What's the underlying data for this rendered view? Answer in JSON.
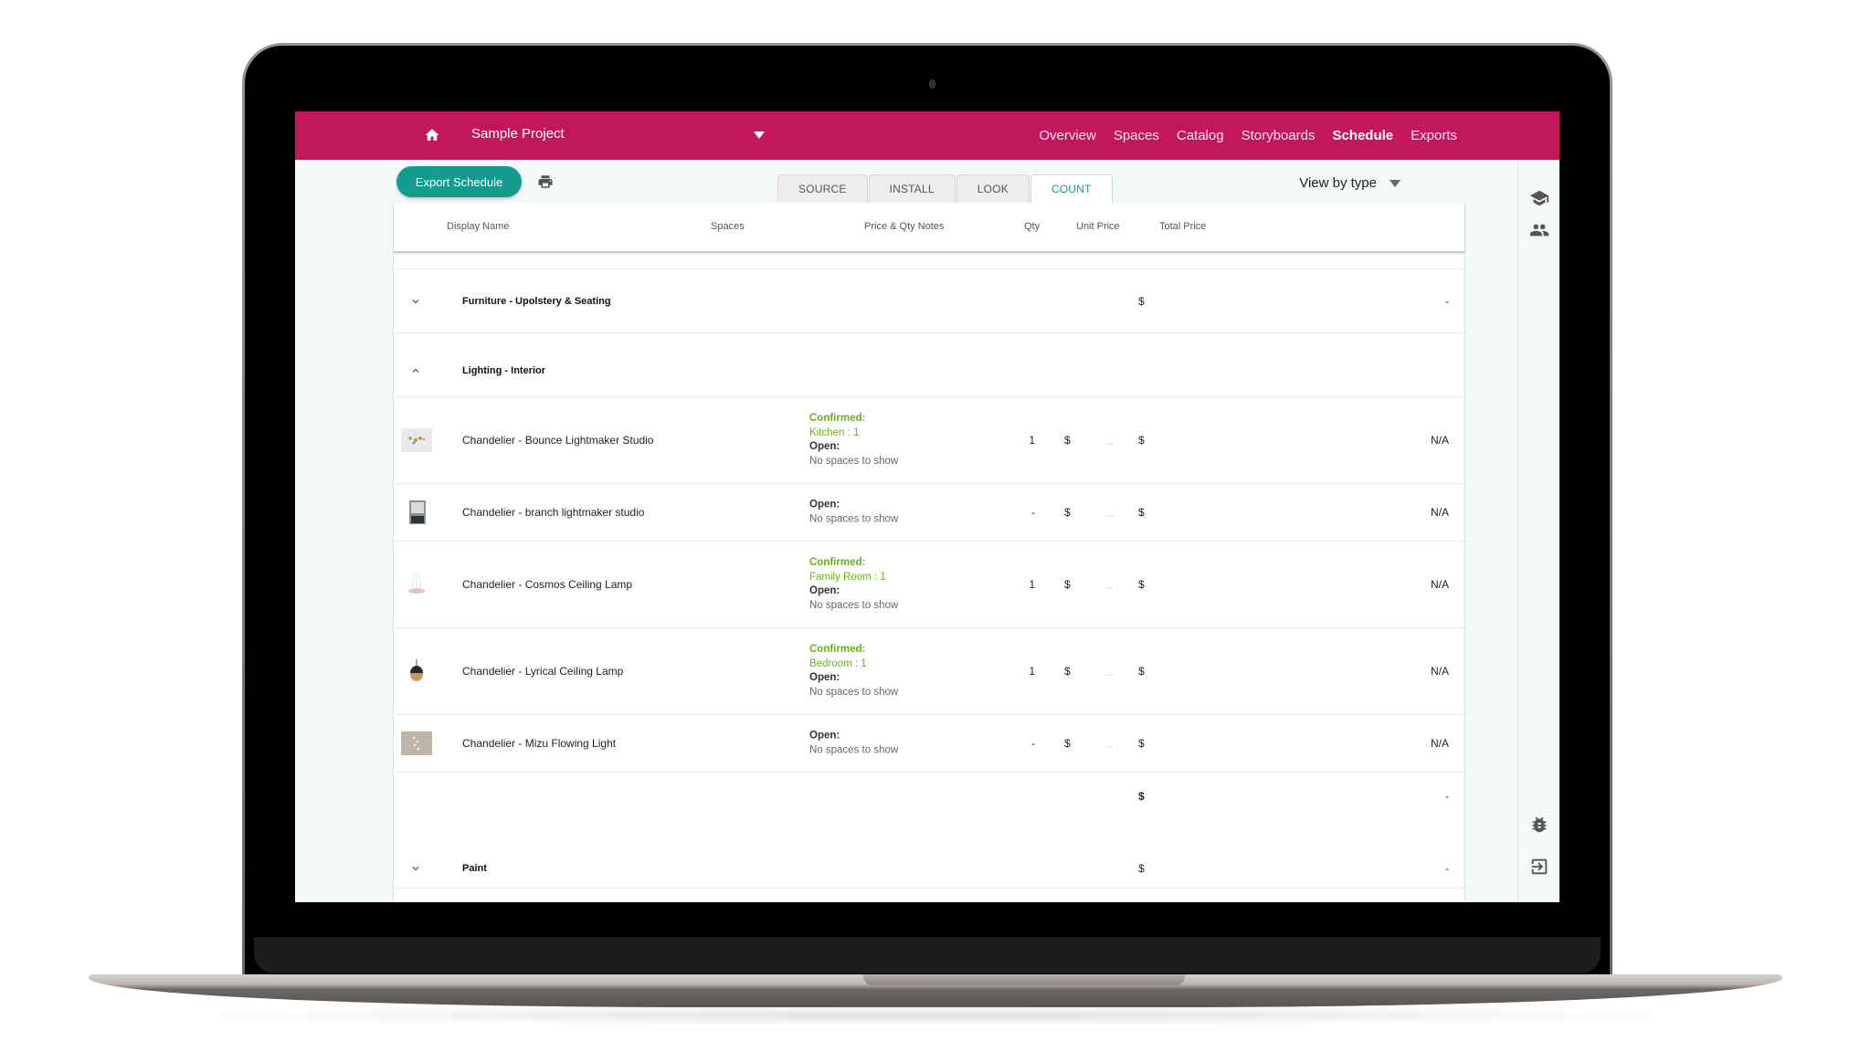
{
  "header": {
    "home_icon": "home-icon",
    "project_name": "Sample Project",
    "nav": [
      {
        "label": "Overview",
        "active": false
      },
      {
        "label": "Spaces",
        "active": false
      },
      {
        "label": "Catalog",
        "active": false
      },
      {
        "label": "Storyboards",
        "active": false
      },
      {
        "label": "Schedule",
        "active": true
      },
      {
        "label": "Exports",
        "active": false
      }
    ]
  },
  "toolbar": {
    "export_label": "Export Schedule",
    "print_icon": "print-icon",
    "tabs": [
      {
        "label": "SOURCE",
        "active": false
      },
      {
        "label": "INSTALL",
        "active": false
      },
      {
        "label": "LOOK",
        "active": false
      },
      {
        "label": "COUNT",
        "active": true
      }
    ],
    "view_by": "View by type"
  },
  "right_rail": {
    "icons": [
      "graduation-cap-icon",
      "people-icon",
      "bug-icon",
      "exit-icon"
    ]
  },
  "table": {
    "columns": {
      "display_name": "Display Name",
      "spaces": "Spaces",
      "price_notes": "Price & Qty Notes",
      "qty": "Qty",
      "unit_price": "Unit Price",
      "total_price": "Total Price"
    },
    "groups": [
      {
        "name": "Furniture - Upolstery & Seating",
        "expanded": false,
        "total_currency": "$",
        "total": "-"
      },
      {
        "name": "Lighting - Interior",
        "expanded": true
      },
      {
        "name": "Paint",
        "expanded": false,
        "total_currency": "$",
        "total": "-"
      }
    ],
    "items": [
      {
        "name": "Chandelier - Bounce Lightmaker Studio",
        "confirmed_label": "Confirmed:",
        "confirmed_value": "Kitchen : 1",
        "open_label": "Open:",
        "open_value": "No spaces to show",
        "qty": "1",
        "unit_currency": "$",
        "unit_price": "...",
        "total_currency": "$",
        "total_price": "N/A"
      },
      {
        "name": "Chandelier - branch lightmaker studio",
        "open_label": "Open:",
        "open_value": "No spaces to show",
        "qty": "-",
        "unit_currency": "$",
        "unit_price": "...",
        "total_currency": "$",
        "total_price": "N/A"
      },
      {
        "name": "Chandelier - Cosmos Ceiling Lamp",
        "confirmed_label": "Confirmed:",
        "confirmed_value": "Family Room : 1",
        "open_label": "Open:",
        "open_value": "No spaces to show",
        "qty": "1",
        "unit_currency": "$",
        "unit_price": "...",
        "total_currency": "$",
        "total_price": "N/A"
      },
      {
        "name": "Chandelier - Lyrical Ceiling Lamp",
        "confirmed_label": "Confirmed:",
        "confirmed_value": "Bedroom : 1",
        "open_label": "Open:",
        "open_value": "No spaces to show",
        "qty": "1",
        "unit_currency": "$",
        "unit_price": "...",
        "total_currency": "$",
        "total_price": "N/A"
      },
      {
        "name": "Chandelier - Mizu Flowing Light",
        "open_label": "Open:",
        "open_value": "No spaces to show",
        "qty": "-",
        "unit_currency": "$",
        "unit_price": "...",
        "total_currency": "$",
        "total_price": "N/A"
      }
    ],
    "lighting_subtotal": {
      "currency": "$",
      "value": "-"
    }
  },
  "colors": {
    "brand": "#c2185b",
    "accent": "#139b8d",
    "confirmed": "#6aaf1a"
  }
}
